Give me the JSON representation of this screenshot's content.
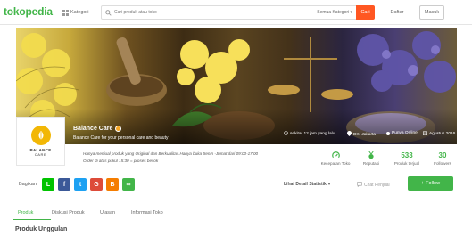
{
  "header": {
    "logo": "tokopedia",
    "kategori_label": "Kategori",
    "search_placeholder": "Cari produk atau toko",
    "search_scope": "Semua Kategori",
    "search_button": "Cari",
    "register_label": "Daftar",
    "login_label": "Masuk"
  },
  "shop": {
    "logo_text_top": "BALANCE",
    "logo_text_bottom": "CARE",
    "name": "Balance Care",
    "tagline": "Balance Care for your personal care and beauty",
    "last_online": "sekitar 12 jam yang lalu",
    "location": "DKI Jakarta",
    "status": "Punya Online",
    "since": "Agustus 2016",
    "notice_line1": "Hanya menjual produk yang Original dan Berkualitas.Hanya buka Senin -Jumat dari 09:00-17:00",
    "notice_line2": "Order di atas pukul 15:30 = proses besok"
  },
  "stats": {
    "items": [
      {
        "label": "Kecepatan Toko",
        "icon": "speed-icon"
      },
      {
        "label": "Reputasi",
        "icon": "medal-icon"
      },
      {
        "label": "Produk terjual",
        "value": "533"
      },
      {
        "label": "Followers",
        "value": "30"
      }
    ]
  },
  "actions": {
    "share_label": "Bagikan",
    "share_buttons": [
      {
        "name": "line",
        "glyph": "L",
        "color": "#00c300"
      },
      {
        "name": "facebook",
        "glyph": "f",
        "color": "#3b5998"
      },
      {
        "name": "twitter",
        "glyph": "t",
        "color": "#1da1f2"
      },
      {
        "name": "google-plus",
        "glyph": "G",
        "color": "#dd4b39"
      },
      {
        "name": "blogger",
        "glyph": "B",
        "color": "#f57d00"
      },
      {
        "name": "link",
        "glyph": "∞",
        "color": "#42b549"
      }
    ],
    "detail_stat_label": "Lihat Detail Statistik",
    "chat_label": "Chat Penjual",
    "follow_label": "Follow"
  },
  "tabs": [
    {
      "label": "Produk",
      "active": true
    },
    {
      "label": "Diskusi Produk",
      "active": false
    },
    {
      "label": "Ulasan",
      "active": false
    },
    {
      "label": "Informasi Toko",
      "active": false
    }
  ],
  "section_title": "Produk Unggulan",
  "colors": {
    "brand_green": "#42b549",
    "search_button": "#ff5722",
    "gold_badge": "#f5a623"
  }
}
